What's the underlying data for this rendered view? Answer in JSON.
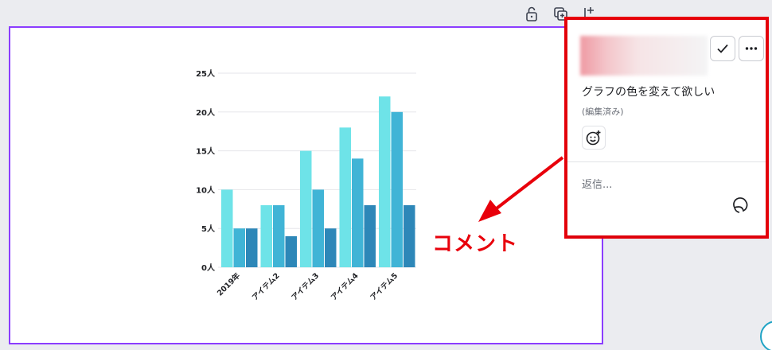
{
  "toolbar": {
    "icons": [
      "lock-icon",
      "duplicate-icon",
      "add-page-icon"
    ]
  },
  "chart_data": {
    "type": "bar",
    "categories": [
      "2019年",
      "アイテム2",
      "アイテム3",
      "アイテム4",
      "アイテム5"
    ],
    "series": [
      {
        "values": [
          10,
          8,
          15,
          18,
          22
        ],
        "color": "#6ee3e8"
      },
      {
        "values": [
          5,
          8,
          10,
          14,
          20
        ],
        "color": "#40b4d6"
      },
      {
        "values": [
          5,
          4,
          5,
          8,
          8
        ],
        "color": "#2d87b8"
      }
    ],
    "yticks": [
      "0人",
      "5人",
      "10人",
      "15人",
      "20人",
      "25人"
    ],
    "ylim": [
      0,
      25
    ],
    "grid": true,
    "legend": "none"
  },
  "comment_panel": {
    "comment_text": "グラフの色を変えて欲しい",
    "edited_label": "(編集済み)",
    "reply_placeholder": "返信...",
    "icons": [
      "check-icon",
      "more-icon",
      "add-reaction-icon",
      "sticker-icon"
    ]
  },
  "annotation": {
    "callout_label": "コメント",
    "color": "#e8000b"
  },
  "colors": {
    "selection": "#8b3dff",
    "background": "#ebecf0"
  }
}
